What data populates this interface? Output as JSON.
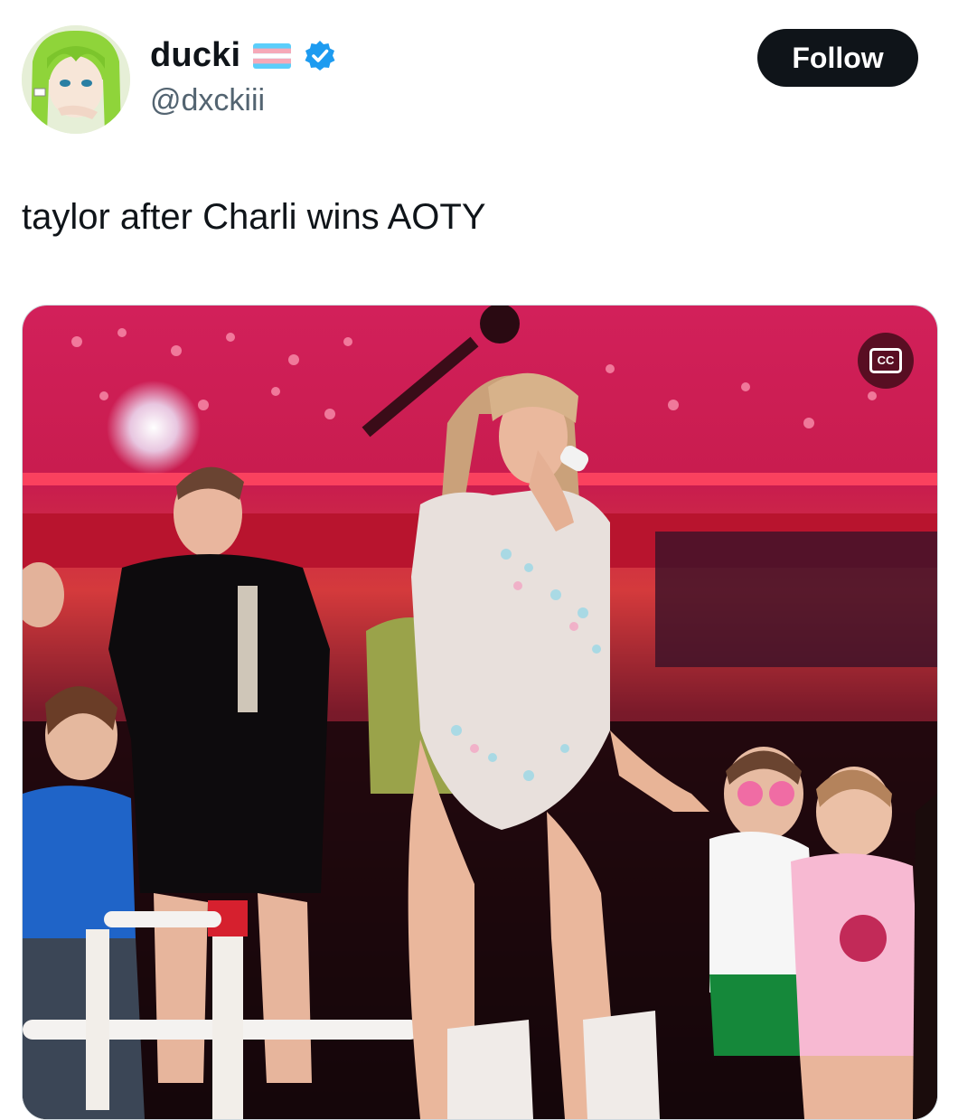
{
  "user": {
    "display_name": "ducki",
    "handle": "@dxckiii",
    "avatar_icon": "anime-avatar-icon",
    "flag_icon": "trans-flag-icon",
    "verified_icon": "verified-badge-icon",
    "verified_color": "#1d9bf0"
  },
  "follow_button": {
    "label": "Follow"
  },
  "tweet": {
    "text": "taylor after Charli wins AOTY"
  },
  "media": {
    "type": "video",
    "cc_label": "CC",
    "cc_icon": "closed-captions-icon"
  },
  "colors": {
    "text_primary": "#0f1419",
    "text_secondary": "#536471",
    "button_bg": "#0f1419",
    "button_text": "#ffffff"
  }
}
